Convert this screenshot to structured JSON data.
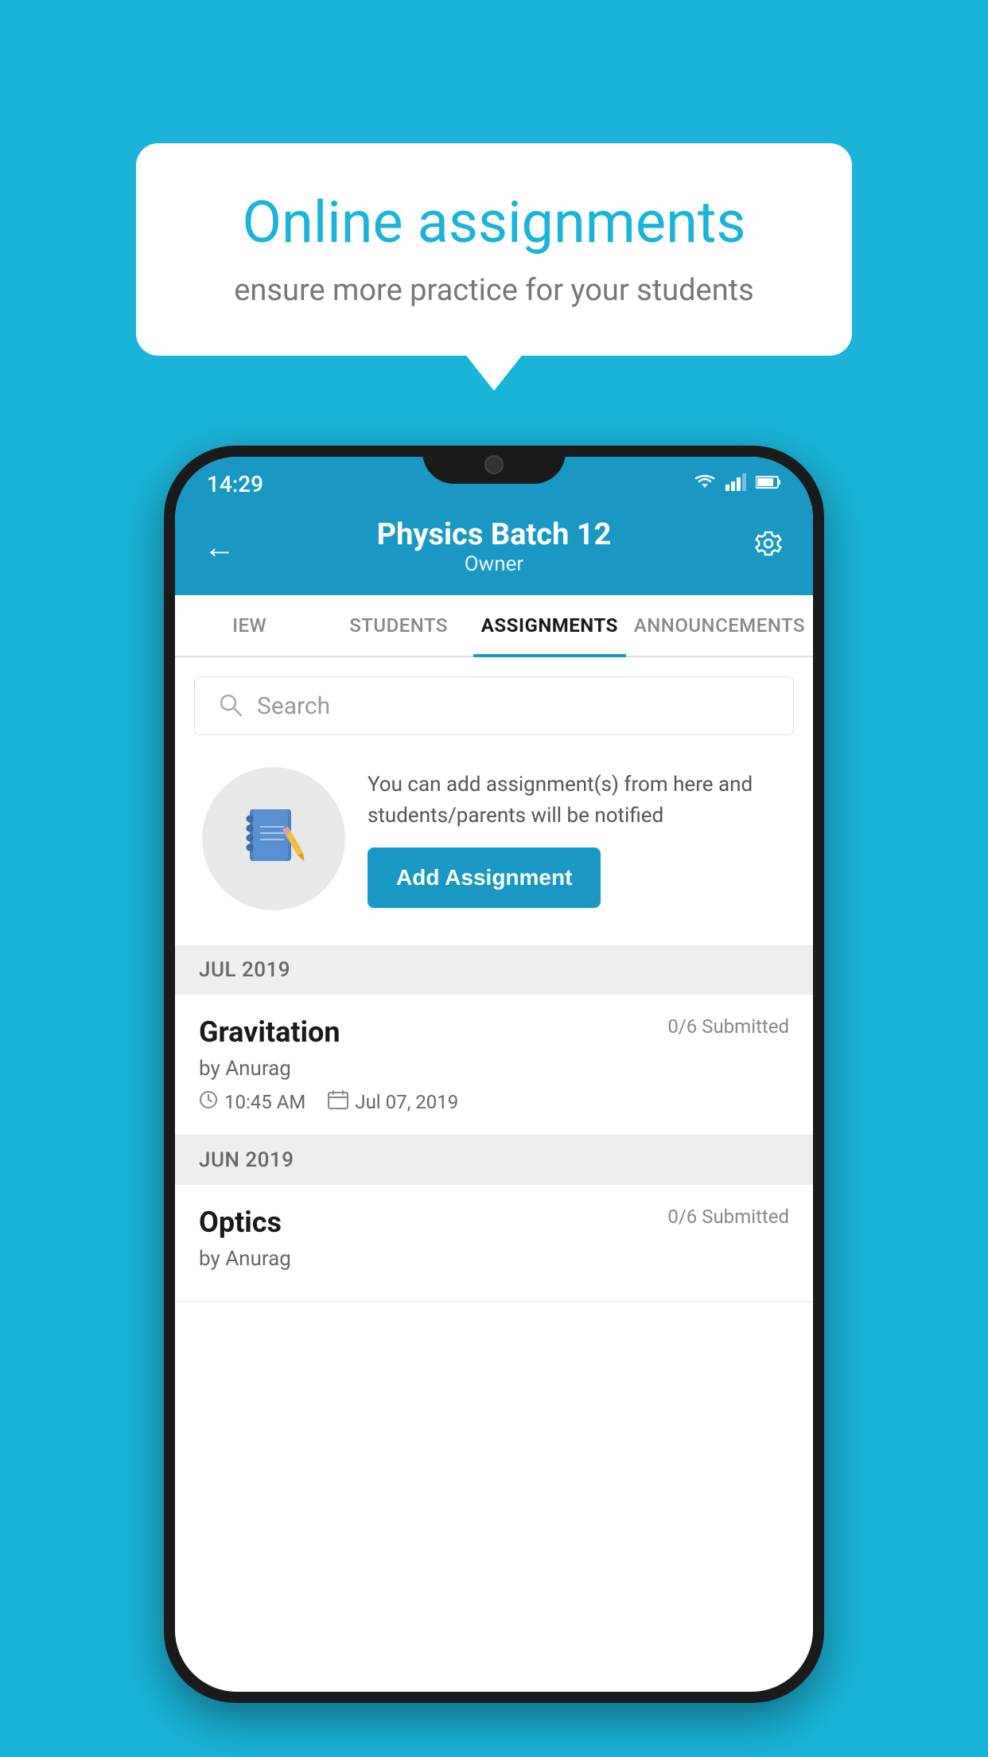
{
  "background_color": "#1ab4d8",
  "promo": {
    "title": "Online assignments",
    "subtitle": "ensure more practice for your students"
  },
  "status_bar": {
    "time": "14:29",
    "wifi_icon": "▼",
    "signal_icon": "◄",
    "battery_icon": "▮"
  },
  "header": {
    "title": "Physics Batch 12",
    "subtitle": "Owner",
    "back_icon": "←",
    "settings_icon": "⚙"
  },
  "tabs": [
    {
      "label": "IEW",
      "active": false
    },
    {
      "label": "STUDENTS",
      "active": false
    },
    {
      "label": "ASSIGNMENTS",
      "active": true
    },
    {
      "label": "ANNOUNCEMENTS",
      "active": false
    }
  ],
  "search": {
    "placeholder": "Search"
  },
  "app_promo": {
    "description": "You can add assignment(s) from here and students/parents will be notified",
    "button_label": "Add Assignment"
  },
  "sections": [
    {
      "label": "JUL 2019",
      "assignments": [
        {
          "name": "Gravitation",
          "submitted": "0/6 Submitted",
          "author": "by Anurag",
          "time": "10:45 AM",
          "date": "Jul 07, 2019"
        }
      ]
    },
    {
      "label": "JUN 2019",
      "assignments": [
        {
          "name": "Optics",
          "submitted": "0/6 Submitted",
          "author": "by Anurag",
          "time": "",
          "date": ""
        }
      ]
    }
  ]
}
